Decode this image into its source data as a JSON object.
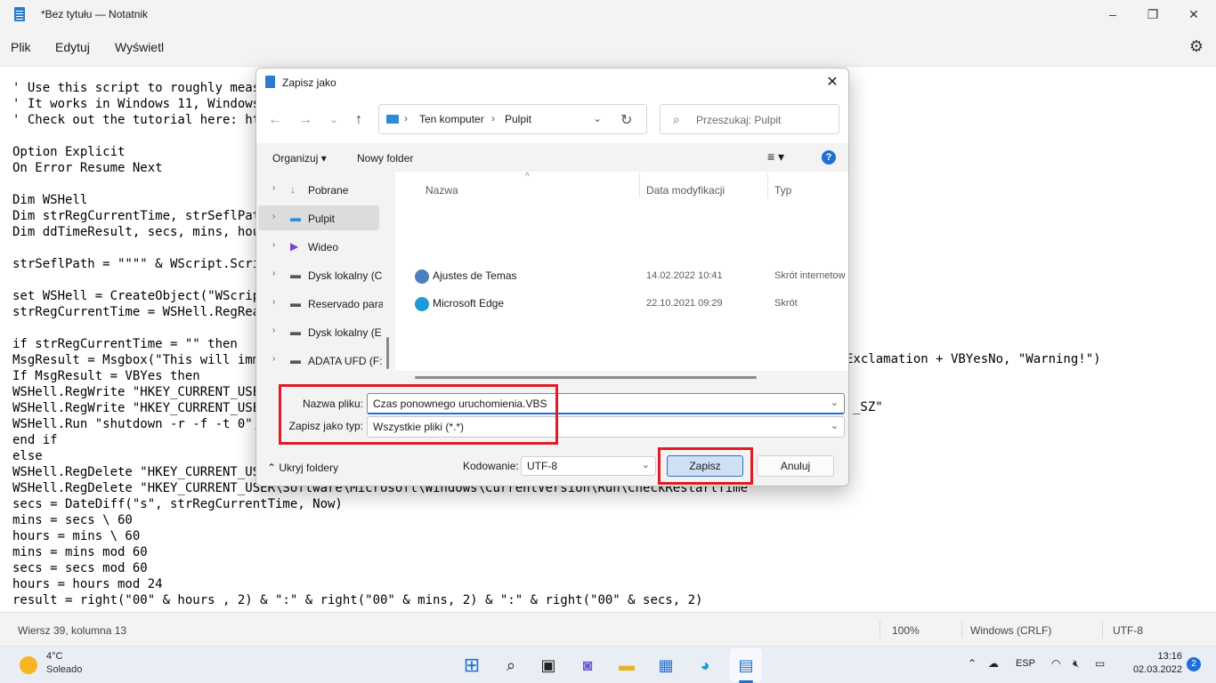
{
  "notepad": {
    "title": "*Bez tytułu — Notatnik",
    "menu": [
      "Plik",
      "Edytuj",
      "Wyświetl"
    ],
    "code_lines": [
      "' Use this script to roughly measu",
      "' It works in Windows 11, Windows",
      "' Check out the tutorial here: htt",
      "",
      "Option Explicit",
      "On Error Resume Next",
      "",
      "Dim WSHell",
      "Dim strRegCurrentTime, strSeflPath",
      "Dim ddTimeResult, secs, mins, hour",
      "",
      "strSeflPath = \"\"\"\" & WScript.Scrip",
      "",
      "set WSHell = CreateObject(\"WScript",
      "strRegCurrentTime = WSHell.RegRead",
      "",
      "if strRegCurrentTime = \"\" then",
      "MsgResult = Msgbox(\"This will imme",
      "If MsgResult = VBYes then",
      "WSHell.RegWrite \"HKEY_CURRENT_USER",
      "WSHell.RegWrite \"HKEY_CURRENT_USER",
      "WSHell.Run \"shutdown -r -f -t 0\",",
      "end if",
      "else",
      "WSHell.RegDelete \"HKEY_CURRENT_USE",
      "WSHell.RegDelete \"HKEY_CURRENT_USER\\Software\\Microsoft\\Windows\\CurrentVersion\\Run\\CheckRestartTime",
      "secs = DateDiff(\"s\", strRegCurrentTime, Now)",
      "mins = secs \\ 60",
      "hours = mins \\ 60",
      "mins = mins mod 60",
      "secs = secs mod 60",
      "hours = hours mod 24",
      "result = right(\"00\" & hours , 2) & \":\" & right(\"00\" & mins, 2) & \":\" & right(\"00\" & secs, 2)"
    ],
    "right_fragments": {
      "line17": "Exclamation + VBYesNo, \"Warning!\")",
      "line20": "_SZ\""
    },
    "status": {
      "position": "Wiersz 39, kolumna 13",
      "zoom": "100%",
      "line_ending": "Windows (CRLF)",
      "encoding": "UTF-8"
    }
  },
  "dialog": {
    "title": "Zapisz jako",
    "breadcrumb": [
      "Ten komputer",
      "Pulpit"
    ],
    "search_placeholder": "Przeszukaj: Pulpit",
    "toolbar": {
      "organize": "Organizuj",
      "new_folder": "Nowy folder"
    },
    "tree": [
      {
        "label": "Pobrane",
        "icon": "download-icon",
        "color": "#2e8bd7"
      },
      {
        "label": "Pulpit",
        "icon": "desktop-icon",
        "color": "#2e8bd7",
        "selected": true
      },
      {
        "label": "Wideo",
        "icon": "video-icon",
        "color": "#7b3fd8"
      },
      {
        "label": "Dysk lokalny (C",
        "icon": "drive-icon",
        "color": "#555555"
      },
      {
        "label": "Reservado para",
        "icon": "drive-icon",
        "color": "#555555"
      },
      {
        "label": "Dysk lokalny (E",
        "icon": "drive-icon",
        "color": "#555555"
      },
      {
        "label": "ADATA UFD (F:)",
        "icon": "drive-icon",
        "color": "#555555"
      }
    ],
    "columns": {
      "name": "Nazwa",
      "modified": "Data modyfikacji",
      "type": "Typ"
    },
    "files": [
      {
        "name": "Ajustes de Temas",
        "modified": "14.02.2022 10:41",
        "type": "Skrót internetow",
        "icon": "theme-settings-icon"
      },
      {
        "name": "Microsoft Edge",
        "modified": "22.10.2021 09:29",
        "type": "Skrót",
        "icon": "edge-icon"
      }
    ],
    "filename_label": "Nazwa pliku:",
    "filename_value": "Czas ponownego uruchomienia.VBS",
    "filetype_label": "Zapisz jako typ:",
    "filetype_value": "Wszystkie pliki  (*.*)",
    "hide_folders": "Ukryj foldery",
    "encoding_label": "Kodowanie:",
    "encoding_value": "UTF-8",
    "save": "Zapisz",
    "cancel": "Anuluj"
  },
  "taskbar": {
    "weather_temp": "4°C",
    "weather_cond": "Soleado",
    "language": "ESP",
    "time": "13:16",
    "date": "02.03.2022",
    "notifications": "2"
  }
}
